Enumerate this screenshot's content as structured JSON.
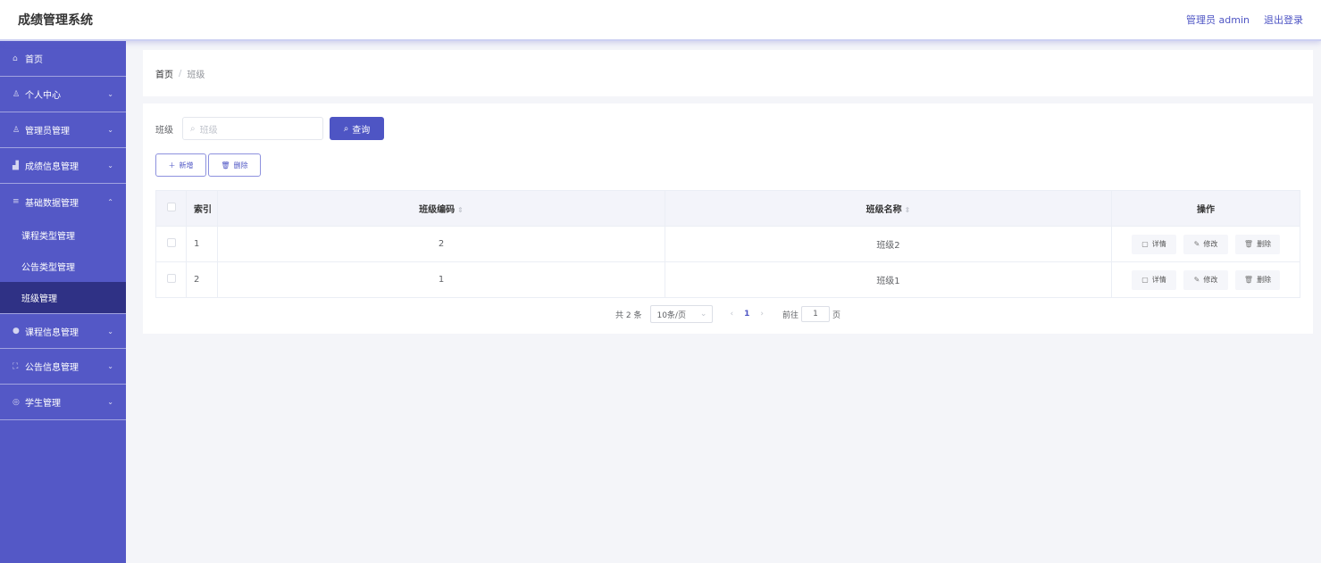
{
  "header": {
    "title": "成绩管理系统",
    "admin_label": "管理员 admin",
    "logout_label": "退出登录"
  },
  "sidebar": {
    "items": [
      {
        "icon": "home-icon",
        "label": "首页",
        "arrow": ""
      },
      {
        "icon": "user-icon",
        "label": "个人中心",
        "arrow": "⌄"
      },
      {
        "icon": "user-icon",
        "label": "管理员管理",
        "arrow": "⌄"
      },
      {
        "icon": "chart-icon",
        "label": "成绩信息管理",
        "arrow": "⌄"
      },
      {
        "icon": "database-icon",
        "label": "基础数据管理",
        "arrow": "⌃"
      },
      {
        "icon": "location-icon",
        "label": "课程信息管理",
        "arrow": "⌄"
      },
      {
        "icon": "fullscreen-icon",
        "label": "公告信息管理",
        "arrow": "⌄"
      },
      {
        "icon": "student-icon",
        "label": "学生管理",
        "arrow": "⌄"
      }
    ],
    "subitems": [
      "课程类型管理",
      "公告类型管理",
      "班级管理"
    ]
  },
  "breadcrumb": {
    "home": "首页",
    "separator": "/",
    "current": "班级"
  },
  "search": {
    "label": "班级",
    "placeholder": "班级",
    "button_label": "查询"
  },
  "actions": {
    "add_label": "新增",
    "delete_label": "删除"
  },
  "table": {
    "columns": {
      "index": "索引",
      "code": "班级编码",
      "name": "班级名称",
      "ops": "操作"
    },
    "rows": [
      {
        "index": "1",
        "code": "2",
        "name": "班级2"
      },
      {
        "index": "2",
        "code": "1",
        "name": "班级1"
      }
    ],
    "row_actions": {
      "detail": "详情",
      "edit": "修改",
      "delete": "删除"
    }
  },
  "pagination": {
    "total": "共 2 条",
    "page_size": "10条/页",
    "current_page": "1",
    "goto_prefix": "前往",
    "goto_value": "1",
    "goto_suffix": "页"
  },
  "colors": {
    "primary": "#4e55c4",
    "sidebar_bg": "#5458c6",
    "sidebar_active": "#2f3185"
  }
}
